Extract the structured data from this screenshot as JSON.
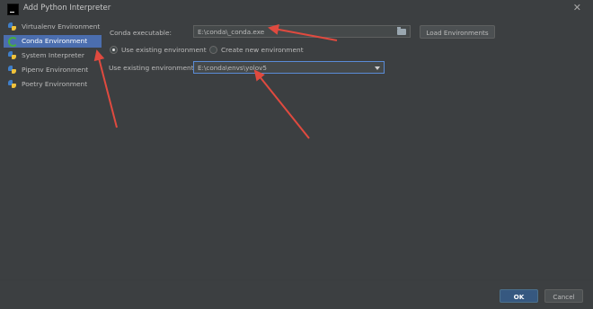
{
  "window": {
    "title": "Add Python Interpreter"
  },
  "sidebar": {
    "items": [
      {
        "label": "Virtualenv Environment",
        "icon": "python-icon",
        "selected": false
      },
      {
        "label": "Conda Environment",
        "icon": "conda-icon",
        "selected": true
      },
      {
        "label": "System Interpreter",
        "icon": "python-icon",
        "selected": false
      },
      {
        "label": "Pipenv Environment",
        "icon": "python-icon",
        "selected": false
      },
      {
        "label": "Poetry Environment",
        "icon": "python-icon",
        "selected": false
      }
    ]
  },
  "main": {
    "conda_executable_label": "Conda executable:",
    "conda_executable_value": "E:\\conda\\_conda.exe",
    "load_environments_label": "Load Environments",
    "radio_existing_label": "Use existing environment",
    "radio_new_label": "Create new environment",
    "existing_env_label": "Use existing environment:",
    "existing_env_value": "E:\\conda\\envs\\yolov5"
  },
  "footer": {
    "ok_label": "OK",
    "cancel_label": "Cancel"
  },
  "colors": {
    "background": "#3c3f41",
    "selection": "#4b6eaf",
    "primary_button": "#365880",
    "annotation_arrow": "#e04a3f"
  }
}
